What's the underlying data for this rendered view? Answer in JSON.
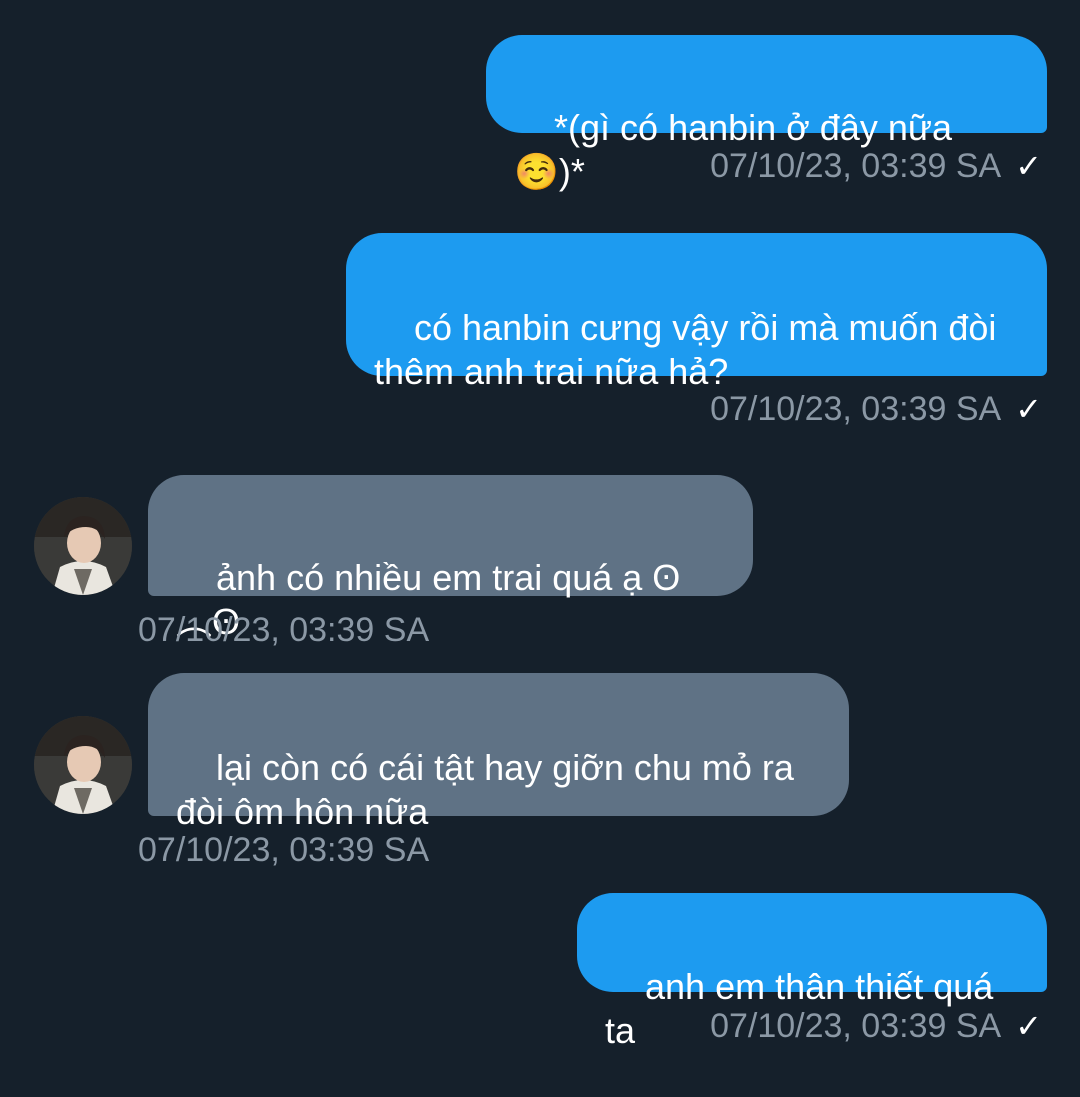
{
  "messages": [
    {
      "direction": "out",
      "text": "*(gì có hanbin ở đây nữa ☺️)*",
      "time": "07/10/23, 03:39 SA",
      "status": "read-check-icon"
    },
    {
      "direction": "out",
      "text": "có hanbin cưng vậy rồi mà muốn đòi\nthêm anh trai nữa hả?",
      "time": "07/10/23, 03:39 SA",
      "status": "read-check-icon"
    },
    {
      "direction": "in",
      "text": "ảnh có nhiều em trai quá ạ ʘ︵ʘ",
      "time": "07/10/23, 03:39 SA"
    },
    {
      "direction": "in",
      "text": "lại còn có cái tật hay giỡn chu mỏ ra\nđòi ôm hôn nữa",
      "time": "07/10/23, 03:39 SA"
    },
    {
      "direction": "out",
      "text": "anh em thân thiết quá ta",
      "time": "07/10/23, 03:39 SA",
      "status": "read-check-icon"
    }
  ],
  "check_glyph": "✓",
  "colors": {
    "background": "#15202b",
    "outgoing_bubble": "#1d9bf0",
    "incoming_bubble": "#5f7285",
    "timestamp": "#8b98a5"
  }
}
